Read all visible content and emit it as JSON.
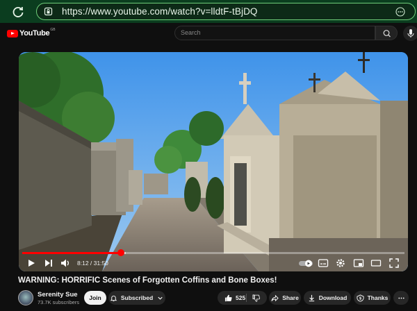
{
  "browser": {
    "url": "https://www.youtube.com/watch?v=lldtF-tBjDQ"
  },
  "header": {
    "logo_text": "YouTube",
    "region": "GB",
    "search_placeholder": "Search"
  },
  "player": {
    "time_display": "8:12 / 31:50",
    "progress_fraction": 0.258,
    "buffer_fraction": 0.27,
    "accent_color": "#ff0000"
  },
  "video": {
    "title": "WARNING: HORRIFIC Scenes of Forgotten Coffins and Bone Boxes!"
  },
  "channel": {
    "name": "Serenity Sue",
    "subscribers": "73.7K subscribers"
  },
  "actions": {
    "join": "Join",
    "subscribed": "Subscribed",
    "likes": "525",
    "share": "Share",
    "download": "Download",
    "thanks": "Thanks"
  }
}
